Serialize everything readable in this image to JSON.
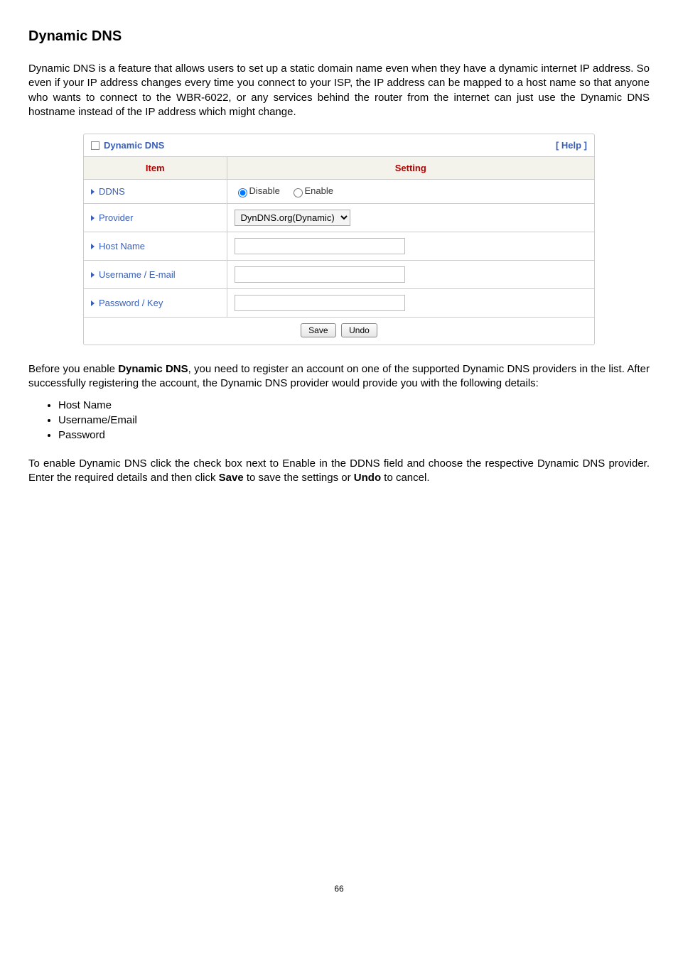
{
  "title": "Dynamic DNS",
  "intro": "Dynamic DNS is a feature that allows users to set up a static domain name even when they have a dynamic internet IP address. So even if your IP address changes every time you connect to your ISP, the IP address can be mapped to a host name so that anyone who wants to connect to the WBR-6022, or any services behind the router from the internet can just use the Dynamic DNS hostname instead of the IP address which might change.",
  "panel": {
    "title": "Dynamic DNS",
    "help_text": "[ Help ]",
    "columns": {
      "item": "Item",
      "setting": "Setting"
    },
    "rows": {
      "ddns": {
        "label": "DDNS",
        "options": {
          "disable": "Disable",
          "enable": "Enable"
        },
        "selected": "disable"
      },
      "provider": {
        "label": "Provider",
        "selected": "DynDNS.org(Dynamic)"
      },
      "hostname": {
        "label": "Host Name",
        "value": ""
      },
      "username": {
        "label": "Username / E-mail",
        "value": ""
      },
      "password": {
        "label": "Password / Key",
        "value": ""
      }
    },
    "buttons": {
      "save": "Save",
      "undo": "Undo"
    }
  },
  "before_enable_prefix": "Before you enable ",
  "before_enable_strong": "Dynamic DNS",
  "before_enable_suffix": ", you need to register an account on one of the supported Dynamic DNS providers in the list. After successfully registering the account, the Dynamic DNS provider would provide you with the following details:",
  "bullets": [
    "Host Name",
    "Username/Email",
    "Password"
  ],
  "to_enable_prefix": "To enable Dynamic DNS click the check box next to Enable in the DDNS field and choose the respective Dynamic DNS provider. Enter the required details and then click ",
  "to_enable_save": "Save",
  "to_enable_mid": " to save the settings or ",
  "to_enable_undo": "Undo",
  "to_enable_suffix": " to cancel.",
  "page_number": "66"
}
